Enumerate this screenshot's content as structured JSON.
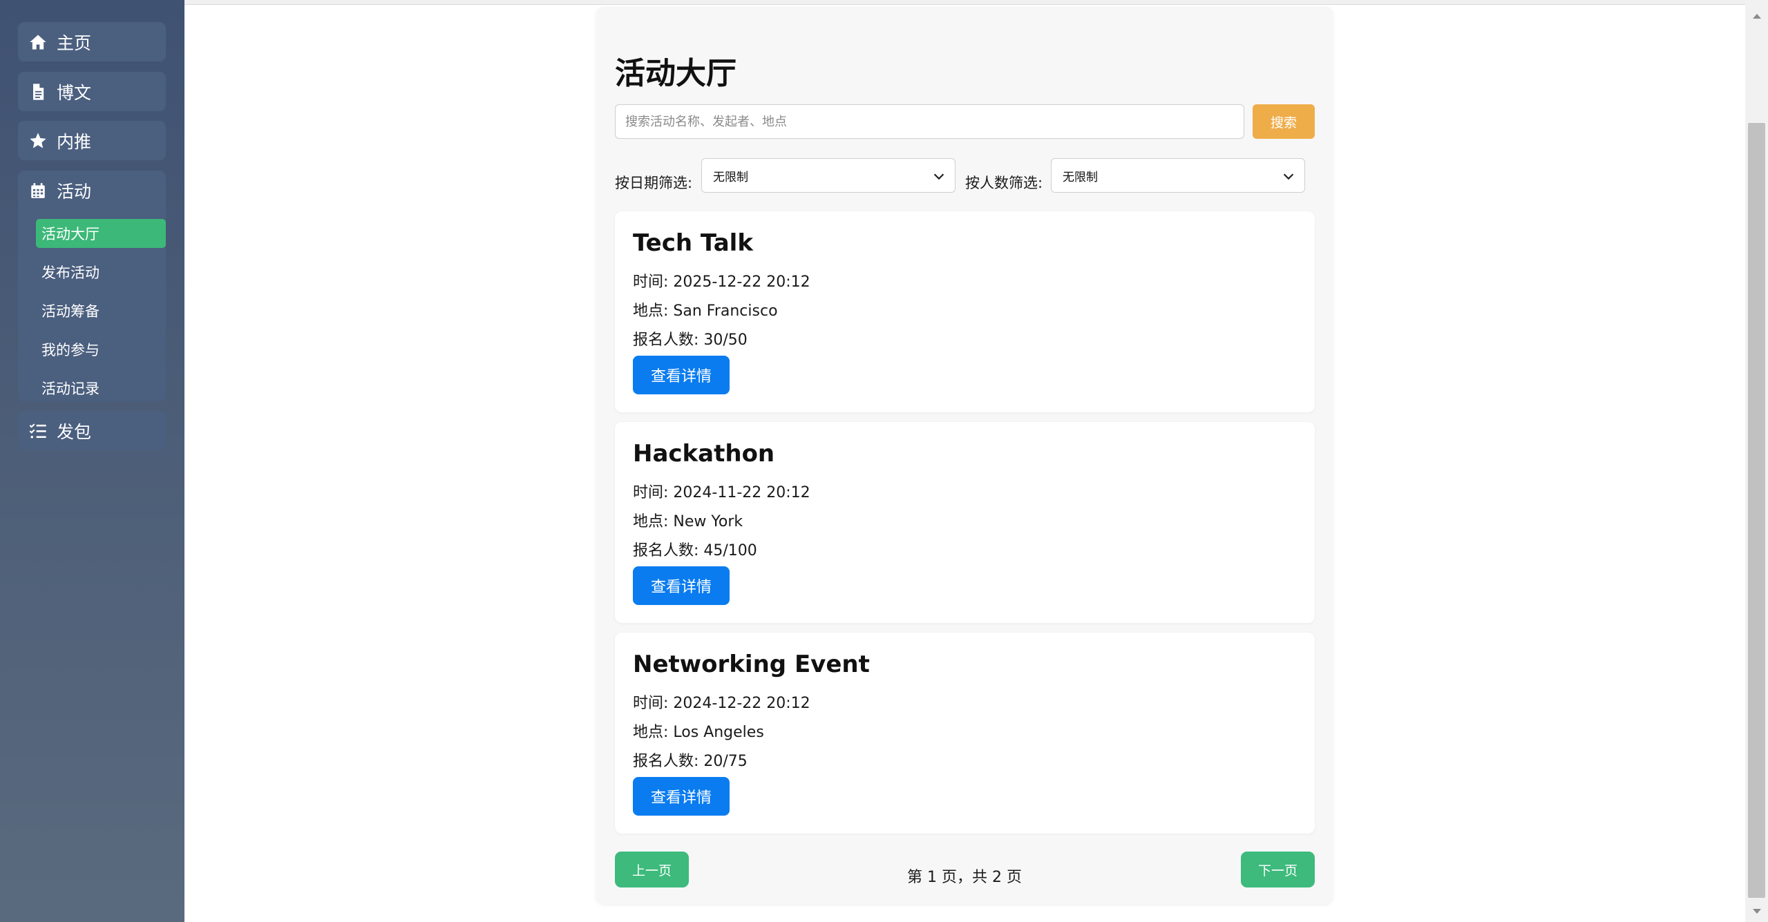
{
  "sidebar": {
    "items": [
      {
        "label": "主页",
        "icon": "home-icon"
      },
      {
        "label": "博文",
        "icon": "document-icon"
      },
      {
        "label": "内推",
        "icon": "star-icon"
      },
      {
        "label": "发包",
        "icon": "checklist-icon"
      }
    ],
    "group": {
      "label": "活动",
      "icon": "calendar-icon",
      "subitems": [
        {
          "label": "活动大厅",
          "active": true
        },
        {
          "label": "发布活动",
          "active": false
        },
        {
          "label": "活动筹备",
          "active": false
        },
        {
          "label": "我的参与",
          "active": false
        },
        {
          "label": "活动记录",
          "active": false
        }
      ]
    }
  },
  "main": {
    "title": "活动大厅",
    "search": {
      "placeholder": "搜索活动名称、发起者、地点",
      "button_label": "搜索"
    },
    "filters": {
      "date_label": "按日期筛选:",
      "date_value": "无限制",
      "people_label": "按人数筛选:",
      "people_value": "无限制"
    },
    "events": [
      {
        "title": "Tech Talk",
        "time": "时间: 2025-12-22 20:12",
        "location": "地点: San Francisco",
        "signups": "报名人数: 30/50",
        "button": "查看详情"
      },
      {
        "title": "Hackathon",
        "time": "时间: 2024-11-22 20:12",
        "location": "地点: New York",
        "signups": "报名人数: 45/100",
        "button": "查看详情"
      },
      {
        "title": "Networking Event",
        "time": "时间: 2024-12-22 20:12",
        "location": "地点: Los Angeles",
        "signups": "报名人数: 20/75",
        "button": "查看详情"
      }
    ],
    "pagination": {
      "prev_label": "上一页",
      "info": "第 1 页，共 2 页",
      "next_label": "下一页"
    }
  },
  "colors": {
    "sidebar_bg": "#4b5f7f",
    "active_green": "#3cb878",
    "search_orange": "#efad4a",
    "detail_blue": "#0a7cf0",
    "page_green": "#3dba7c"
  }
}
